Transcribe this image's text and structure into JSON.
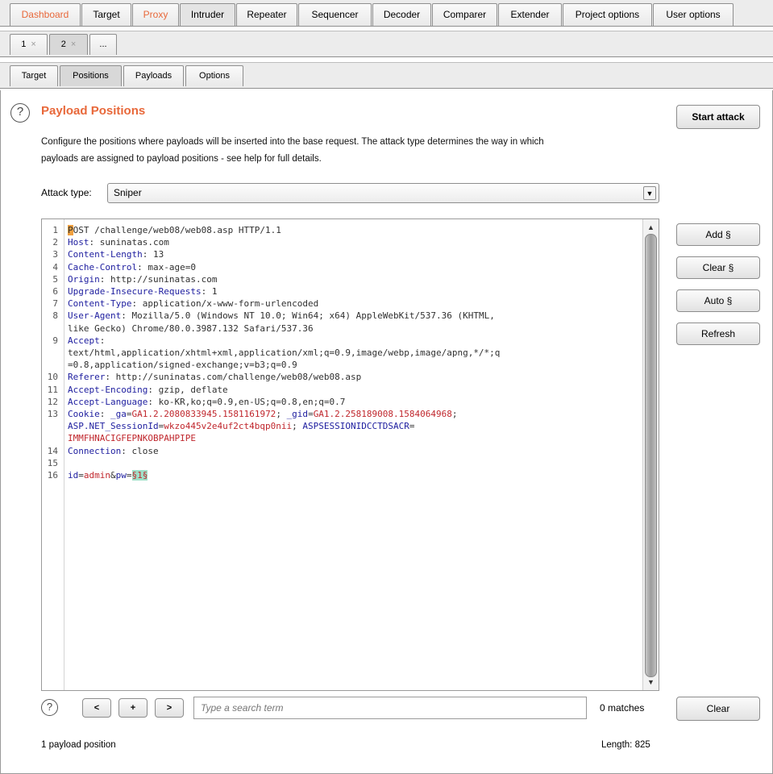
{
  "top_tabs": [
    {
      "label": "Dashboard",
      "orange": true,
      "selected": false
    },
    {
      "label": "Target",
      "orange": false,
      "selected": false
    },
    {
      "label": "Proxy",
      "orange": true,
      "selected": false
    },
    {
      "label": "Intruder",
      "orange": false,
      "selected": true
    },
    {
      "label": "Repeater",
      "orange": false,
      "selected": false
    },
    {
      "label": "Sequencer",
      "orange": false,
      "selected": false
    },
    {
      "label": "Decoder",
      "orange": false,
      "selected": false
    },
    {
      "label": "Comparer",
      "orange": false,
      "selected": false
    },
    {
      "label": "Extender",
      "orange": false,
      "selected": false
    },
    {
      "label": "Project options",
      "orange": false,
      "selected": false
    },
    {
      "label": "User options",
      "orange": false,
      "selected": false
    }
  ],
  "attack_tabs": [
    {
      "label": "1",
      "close": "×",
      "selected": false
    },
    {
      "label": "2",
      "close": "×",
      "selected": true
    },
    {
      "label": "...",
      "close": "",
      "selected": false
    }
  ],
  "sub_tabs": [
    {
      "label": "Target",
      "selected": false
    },
    {
      "label": "Positions",
      "selected": true
    },
    {
      "label": "Payloads",
      "selected": false
    },
    {
      "label": "Options",
      "selected": false
    }
  ],
  "section": {
    "help_glyph": "?",
    "title": "Payload Positions",
    "description_line1": "Configure the positions where payloads will be inserted into the base request. The attack type determines the way in which",
    "description_line2": "payloads are assigned to payload positions - see help for full details.",
    "start_attack": "Start attack"
  },
  "attack_type": {
    "label": "Attack type:",
    "value": "Sniper"
  },
  "side_buttons": {
    "add": "Add §",
    "clear": "Clear §",
    "auto": "Auto §",
    "refresh": "Refresh"
  },
  "request_lines": [
    {
      "n": "1",
      "segs": [
        {
          "t": "P",
          "c": "cursor-char"
        },
        {
          "t": "OST /challenge/web08/web08.asp HTTP/1.1",
          "c": ""
        }
      ]
    },
    {
      "n": "2",
      "segs": [
        {
          "t": "Host",
          "c": "h"
        },
        {
          "t": ": suninatas.com",
          "c": ""
        }
      ]
    },
    {
      "n": "3",
      "segs": [
        {
          "t": "Content-Length",
          "c": "h"
        },
        {
          "t": ": 13",
          "c": ""
        }
      ]
    },
    {
      "n": "4",
      "segs": [
        {
          "t": "Cache-Control",
          "c": "h"
        },
        {
          "t": ": max-age=0",
          "c": ""
        }
      ]
    },
    {
      "n": "5",
      "segs": [
        {
          "t": "Origin",
          "c": "h"
        },
        {
          "t": ": http://suninatas.com",
          "c": ""
        }
      ]
    },
    {
      "n": "6",
      "segs": [
        {
          "t": "Upgrade-Insecure-Requests",
          "c": "h"
        },
        {
          "t": ": 1",
          "c": ""
        }
      ]
    },
    {
      "n": "7",
      "segs": [
        {
          "t": "Content-Type",
          "c": "h"
        },
        {
          "t": ": application/x-www-form-urlencoded",
          "c": ""
        }
      ]
    },
    {
      "n": "8",
      "segs": [
        {
          "t": "User-Agent",
          "c": "h"
        },
        {
          "t": ": Mozilla/5.0 (Windows NT 10.0; Win64; x64) AppleWebKit/537.36 (KHTML,",
          "c": ""
        }
      ]
    },
    {
      "n": "",
      "segs": [
        {
          "t": "like Gecko) Chrome/80.0.3987.132 Safari/537.36",
          "c": ""
        }
      ]
    },
    {
      "n": "9",
      "segs": [
        {
          "t": "Accept",
          "c": "h"
        },
        {
          "t": ":",
          "c": ""
        }
      ]
    },
    {
      "n": "",
      "segs": [
        {
          "t": "text/html,application/xhtml+xml,application/xml;q=0.9,image/webp,image/apng,*/*;q",
          "c": ""
        }
      ]
    },
    {
      "n": "",
      "segs": [
        {
          "t": "=0.8,application/signed-exchange;v=b3;q=0.9",
          "c": ""
        }
      ]
    },
    {
      "n": "10",
      "segs": [
        {
          "t": "Referer",
          "c": "h"
        },
        {
          "t": ": http://suninatas.com/challenge/web08/web08.asp",
          "c": ""
        }
      ]
    },
    {
      "n": "11",
      "segs": [
        {
          "t": "Accept-Encoding",
          "c": "h"
        },
        {
          "t": ": gzip, deflate",
          "c": ""
        }
      ]
    },
    {
      "n": "12",
      "segs": [
        {
          "t": "Accept-Language",
          "c": "h"
        },
        {
          "t": ": ko-KR,ko;q=0.9,en-US;q=0.8,en;q=0.7",
          "c": ""
        }
      ]
    },
    {
      "n": "13",
      "segs": [
        {
          "t": "Cookie",
          "c": "h"
        },
        {
          "t": ": ",
          "c": ""
        },
        {
          "t": "_ga",
          "c": "h"
        },
        {
          "t": "=",
          "c": ""
        },
        {
          "t": "GA1.2.2080833945.1581161972",
          "c": "r"
        },
        {
          "t": "; ",
          "c": ""
        },
        {
          "t": "_gid",
          "c": "h"
        },
        {
          "t": "=",
          "c": ""
        },
        {
          "t": "GA1.2.258189008.1584064968",
          "c": "r"
        },
        {
          "t": ";",
          "c": ""
        }
      ]
    },
    {
      "n": "",
      "segs": [
        {
          "t": "ASP.NET_SessionId",
          "c": "h"
        },
        {
          "t": "=",
          "c": ""
        },
        {
          "t": "wkzo445v2e4uf2ct4bqp0nii",
          "c": "r"
        },
        {
          "t": "; ",
          "c": ""
        },
        {
          "t": "ASPSESSIONIDCCTDSACR",
          "c": "h"
        },
        {
          "t": "=",
          "c": ""
        }
      ]
    },
    {
      "n": "",
      "segs": [
        {
          "t": "IMMFHNACIGFEPNKOBPAHPIPE",
          "c": "r"
        }
      ]
    },
    {
      "n": "14",
      "segs": [
        {
          "t": "Connection",
          "c": "h"
        },
        {
          "t": ": close",
          "c": ""
        }
      ]
    },
    {
      "n": "15",
      "segs": []
    },
    {
      "n": "16",
      "segs": [
        {
          "t": "id",
          "c": "h"
        },
        {
          "t": "=",
          "c": ""
        },
        {
          "t": "admin",
          "c": "r"
        },
        {
          "t": "&",
          "c": ""
        },
        {
          "t": "pw",
          "c": "h"
        },
        {
          "t": "=",
          "c": ""
        },
        {
          "t": "§1§",
          "c": "mark r"
        }
      ]
    }
  ],
  "search": {
    "help_glyph": "?",
    "prev": "<",
    "add": "+",
    "next": ">",
    "placeholder": "Type a search term",
    "matches": "0 matches",
    "clear": "Clear"
  },
  "status": {
    "positions": "1 payload position",
    "length": "Length: 825"
  },
  "scroll_arrows": {
    "up": "▲",
    "down": "▼"
  },
  "dropdown_arrow": "▼"
}
